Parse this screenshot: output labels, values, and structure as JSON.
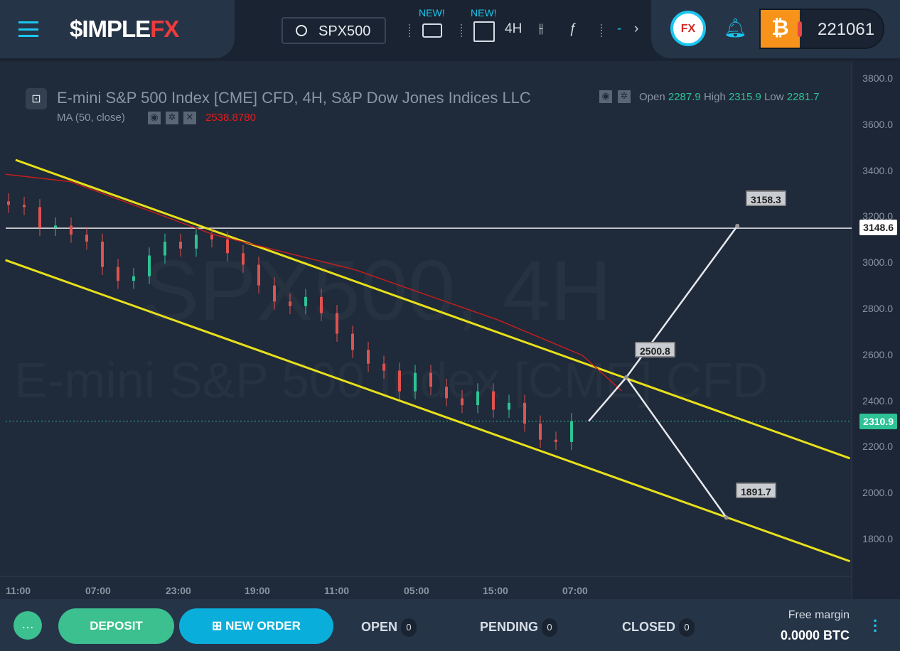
{
  "header": {
    "logo_a": "$IMPLE",
    "logo_b": "FX",
    "search_value": "SPX500",
    "new_badge_1": "NEW!",
    "new_badge_2": "NEW!",
    "interval": "4H",
    "fx_badge": "FX",
    "balance": "221061",
    "currency_icon": "bitcoin-icon"
  },
  "chart_info": {
    "title": "E-mini S&P 500 Index [CME] CFD, 4H, S&P Dow Jones Indices LLC",
    "open_label": "Open",
    "open": "2287.9",
    "high_label": "High",
    "high": "2315.9",
    "low_label": "Low",
    "low": "2281.7",
    "ma_label": "MA (50, close)",
    "ma_value": "2538.8780",
    "watermark_1": "SPX500, 4H",
    "watermark_2": "E-mini S&P 500 Index [CME] CFD"
  },
  "chart_data": {
    "type": "candlestick",
    "ylim": [
      1700,
      3850
    ],
    "yticks": [
      "3800.0",
      "3600.0",
      "3400.0",
      "3200.0",
      "3000.0",
      "2800.0",
      "2600.0",
      "2400.0",
      "2200.0",
      "2000.0",
      "1800.0"
    ],
    "xticks": [
      "11:00",
      "07:00",
      "23:00",
      "19:00",
      "11:00",
      "05:00",
      "15:00",
      "07:00"
    ],
    "closes": [
      3250,
      3240,
      3150,
      3160,
      3120,
      3090,
      2980,
      2920,
      2940,
      3030,
      3090,
      3060,
      3120,
      3100,
      3040,
      2990,
      2900,
      2830,
      2810,
      2850,
      2780,
      2690,
      2620,
      2560,
      2530,
      2440,
      2520,
      2460,
      2410,
      2380,
      2440,
      2360,
      2390,
      2300,
      2230,
      2220,
      2311
    ],
    "ma": [
      [
        -0.2,
        3383
      ],
      [
        4,
        3350
      ],
      [
        13.1,
        3121
      ],
      [
        22.2,
        2967
      ],
      [
        31.3,
        2750
      ],
      [
        36.7,
        2596
      ],
      [
        39.2,
        2442
      ]
    ],
    "channel_upper": [
      [
        0.45,
        3445
      ],
      [
        53.8,
        2149
      ]
    ],
    "channel_lower": [
      [
        -0.2,
        3010
      ],
      [
        53.8,
        1702
      ]
    ],
    "horizontal_level": "3148.6",
    "current_price": "2310.9",
    "projection_up": [
      [
        37.1,
        2311
      ],
      [
        39.5,
        2500.8
      ],
      [
        46.6,
        3158.3
      ]
    ],
    "projection_down": [
      [
        39.5,
        2500.8
      ],
      [
        45.9,
        1891.7
      ]
    ],
    "targets": [
      "3158.3",
      "2500.8",
      "1891.7"
    ],
    "colors": {
      "up": "#2ec295",
      "down": "#e0524f",
      "ma": "#c41e1e",
      "channel": "#e8e01a",
      "projection": "#e6e9ee"
    }
  },
  "footer": {
    "deposit": "DEPOSIT",
    "new_order": "NEW ORDER",
    "open": "OPEN",
    "open_count": "0",
    "pending": "PENDING",
    "pending_count": "0",
    "closed": "CLOSED",
    "closed_count": "0",
    "free_margin_label": "Free margin",
    "free_margin_value": "0.0000 BTC"
  }
}
